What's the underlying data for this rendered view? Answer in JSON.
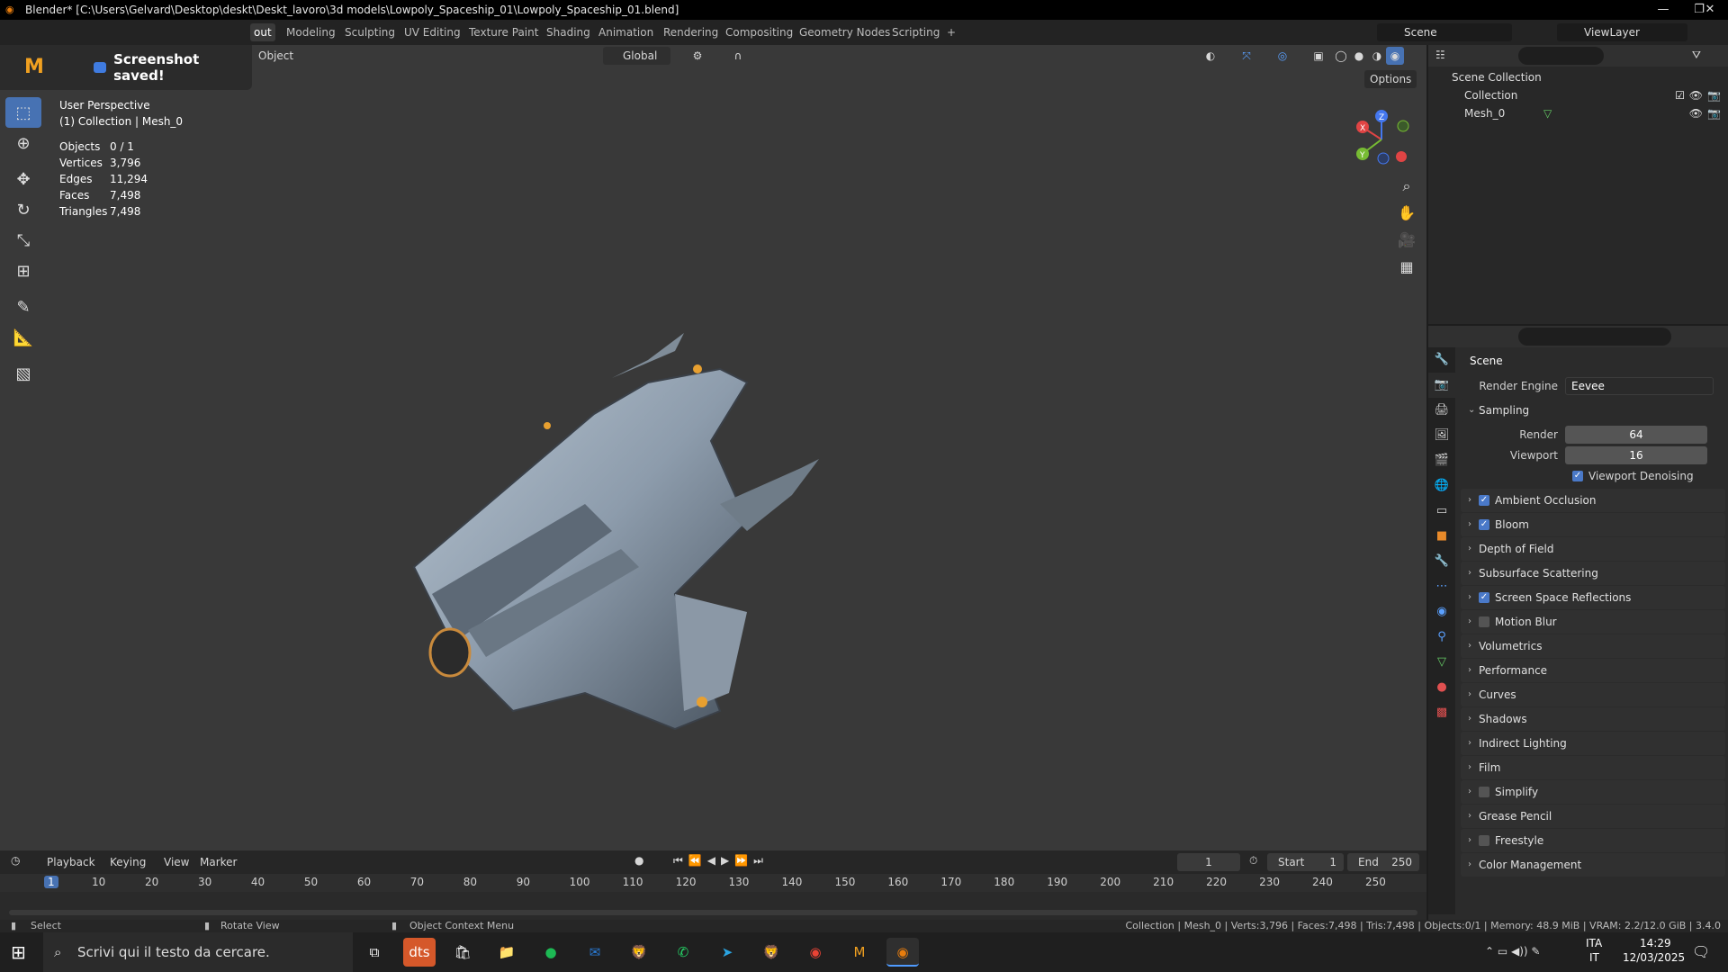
{
  "window": {
    "title": "Blender* [C:\\Users\\Gelvard\\Desktop\\deskt\\Deskt_lavoro\\3d models\\Lowpoly_Spaceship_01\\Lowpoly_Spaceship_01.blend]",
    "minimize": "—",
    "maximize": "❐",
    "close": "✕"
  },
  "workspaces": [
    "out",
    "Modeling",
    "Sculpting",
    "UV Editing",
    "Texture Paint",
    "Shading",
    "Animation",
    "Rendering",
    "Compositing",
    "Geometry Nodes",
    "Scripting",
    "+"
  ],
  "scene_name": "Scene",
  "view_layer": "ViewLayer",
  "notification": "Screenshot saved!",
  "viewport": {
    "mode": "Object",
    "transform_orientation": "Global",
    "options": "Options",
    "view_name": "User Perspective",
    "collection_info": "(1) Collection | Mesh_0",
    "stats": [
      {
        "k": "Objects",
        "v": "0 / 1"
      },
      {
        "k": "Vertices",
        "v": "3,796"
      },
      {
        "k": "Edges",
        "v": "11,294"
      },
      {
        "k": "Faces",
        "v": "7,498"
      },
      {
        "k": "Triangles",
        "v": "7,498"
      }
    ]
  },
  "outliner": {
    "scene_collection": "Scene Collection",
    "collection": "Collection",
    "mesh": "Mesh_0"
  },
  "properties": {
    "title": "Scene",
    "render_engine_label": "Render Engine",
    "render_engine": "Eevee",
    "sampling": "Sampling",
    "render_label": "Render",
    "render_value": "64",
    "viewport_label": "Viewport",
    "viewport_value": "16",
    "viewport_denoising": "Viewport Denoising",
    "panels": [
      {
        "label": "Ambient Occlusion",
        "check": true
      },
      {
        "label": "Bloom",
        "check": true
      },
      {
        "label": "Depth of Field",
        "check": null
      },
      {
        "label": "Subsurface Scattering",
        "check": null
      },
      {
        "label": "Screen Space Reflections",
        "check": true
      },
      {
        "label": "Motion Blur",
        "check": false
      },
      {
        "label": "Volumetrics",
        "check": null
      },
      {
        "label": "Performance",
        "check": null
      },
      {
        "label": "Curves",
        "check": null
      },
      {
        "label": "Shadows",
        "check": null
      },
      {
        "label": "Indirect Lighting",
        "check": null
      },
      {
        "label": "Film",
        "check": null
      },
      {
        "label": "Simplify",
        "check": false
      },
      {
        "label": "Grease Pencil",
        "check": null
      },
      {
        "label": "Freestyle",
        "check": false
      },
      {
        "label": "Color Management",
        "check": null
      }
    ]
  },
  "timeline": {
    "playback": "Playback",
    "keying": "Keying",
    "view": "View",
    "marker": "Marker",
    "current_frame": "1",
    "start_label": "Start",
    "start": "1",
    "end_label": "End",
    "end": "250",
    "ticks": [
      "1",
      "10",
      "20",
      "30",
      "40",
      "50",
      "60",
      "70",
      "80",
      "90",
      "100",
      "110",
      "120",
      "130",
      "140",
      "150",
      "160",
      "170",
      "180",
      "190",
      "200",
      "210",
      "220",
      "230",
      "240",
      "250"
    ]
  },
  "statusbar": {
    "select": "Select",
    "rotate": "Rotate View",
    "context": "Object Context Menu",
    "info": "Collection | Mesh_0 | Verts:3,796 | Faces:7,498 | Tris:7,498 | Objects:0/1 | Memory: 48.9 MiB | VRAM: 2.2/12.0 GiB | 3.4.0"
  },
  "taskbar": {
    "search_placeholder": "Scrivi qui il testo da cercare.",
    "lang1": "ITA",
    "lang2": "IT",
    "time": "14:29",
    "date": "12/03/2025"
  }
}
